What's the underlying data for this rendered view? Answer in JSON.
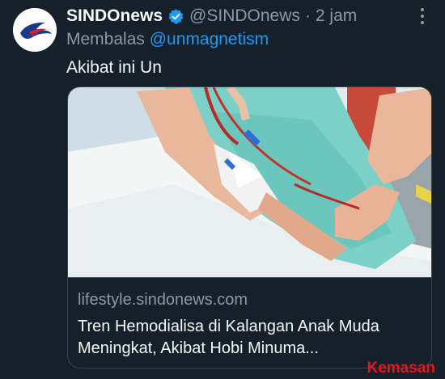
{
  "tweet": {
    "account_name": "SINDOnews",
    "handle": "@SINDOnews",
    "separator": "·",
    "time": "2 jam",
    "replying_prefix": "Membalas",
    "replying_to": "@unmagnetism",
    "text": "Akibat ini Un"
  },
  "card": {
    "domain": "lifestyle.sindonews.com",
    "title": "Tren Hemodialisa di Kalangan Anak Muda Meningkat, Akibat Hobi Minuma..."
  },
  "watermark": "Kemasan",
  "icons": {
    "avatar": "sindonews-logo",
    "verified": "verified-badge-icon",
    "more": "more-options-icon"
  },
  "colors": {
    "background": "#15202b",
    "accent": "#1d9bf0",
    "muted": "#8b98a5",
    "watermark": "#e8141a"
  }
}
